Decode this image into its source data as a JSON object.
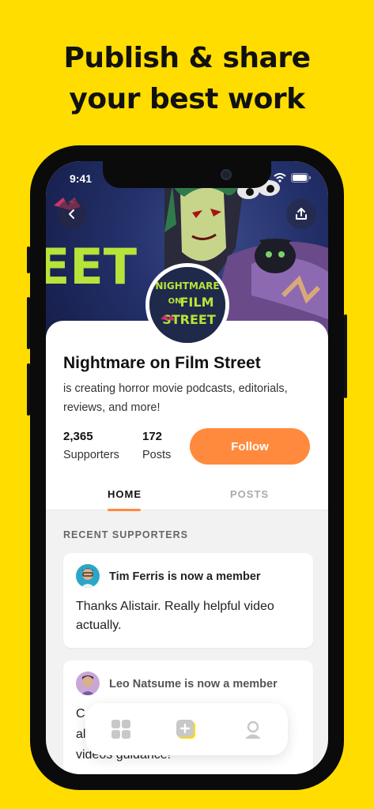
{
  "headline": {
    "line1": "Publish & share",
    "line2": "your best work"
  },
  "status_bar": {
    "time": "9:41",
    "icons": [
      "signal-icon",
      "wifi-icon",
      "battery-icon"
    ]
  },
  "header": {
    "back_icon": "back-arrow-icon",
    "share_icon": "share-icon",
    "banner_text": "EET"
  },
  "creator": {
    "avatar_text": [
      "NIGHTMARE",
      "ON",
      "FILM",
      "STREET"
    ],
    "name": "Nightmare on Film Street",
    "description": "is creating horror movie podcasts, editorials, reviews, and more!",
    "stats": [
      {
        "value": "2,365",
        "label": "Supporters"
      },
      {
        "value": "172",
        "label": "Posts"
      }
    ],
    "follow_label": "Follow"
  },
  "tabs": [
    {
      "label": "HOME",
      "active": true
    },
    {
      "label": "POSTS",
      "active": false
    }
  ],
  "recent_supporters": {
    "label": "RECENT SUPPORTERS",
    "items": [
      {
        "title": "Tim Ferris is now a member",
        "message": "Thanks Alistair. Really helpful video actually."
      },
      {
        "title": "Leo Natsume is now a member",
        "message_line1": "C",
        "message_line2": "alo",
        "message_line3": "videos guidance!"
      }
    ]
  },
  "bottom_nav": {
    "items": [
      "grid-icon",
      "add-icon",
      "profile-icon"
    ]
  },
  "colors": {
    "background": "#FFDD00",
    "accent": "#FF8A3D"
  }
}
